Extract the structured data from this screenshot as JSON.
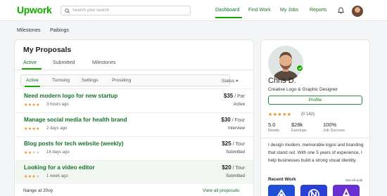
{
  "brand": {
    "logo": "Upwork",
    "accent": "#14a800",
    "link_green": "#16732c",
    "star_color": "#ef8b1a"
  },
  "header": {
    "search_placeholder": "Search your search",
    "nav": [
      "Dashboard",
      "Find Work",
      "My Jobs",
      "Reports"
    ],
    "active_nav": "Dashboard",
    "icons": [
      "search-icon",
      "bell-icon",
      "avatar"
    ]
  },
  "subnav": [
    "Milestones",
    "Paibings"
  ],
  "proposals": {
    "title": "My Proposals",
    "tabs": [
      "Active",
      "Submitted",
      "Milestones"
    ],
    "active_tab": "Active",
    "subtabs": [
      "Active",
      "Turnsing",
      "Settings",
      "Prosiding"
    ],
    "status_filter": "Status",
    "rows": [
      {
        "title": "Need modern logo for new startup",
        "rating": 4,
        "ago": "3 hours ago",
        "price": "$35",
        "unit": " / Par",
        "status": "Active",
        "highlight": false
      },
      {
        "title": "Manage social media for health brand",
        "rating": 4,
        "ago": "2 days ago",
        "price": "$30",
        "unit": " / Four",
        "status": "Interview",
        "highlight": false
      },
      {
        "title": "Blog posts for tech website (weekly)",
        "rating": 2,
        "ago": "16 days ago",
        "price": "$25",
        "unit": " / Tour",
        "status": "Submitted",
        "highlight": false
      },
      {
        "title": "Looking for a video editor",
        "rating": 3,
        "ago": "1 week ago",
        "price": "$20",
        "unit": " / Tour",
        "status": "Submitted",
        "highlight": true
      }
    ],
    "footer_range": "Nange at 20oy",
    "footer_link": "View all proposals"
  },
  "profile": {
    "name": "Chris D.",
    "role": "Creative Logo & Graphic Designer",
    "button": "Profile",
    "rating_stars": 5,
    "rating_text": "(0 142)",
    "stats": [
      {
        "value": "5.0",
        "label": "Reads"
      },
      {
        "value": "$28k",
        "label": "Earnings"
      },
      {
        "value": "100%",
        "label": "Job Success"
      }
    ],
    "bio": "I design modern, memorable logos and branding that stand out. With one 5 years of experience, I help businesses build a strong visual identity.",
    "recent_work_title": "Recent Work",
    "see_all": "See all work",
    "works": [
      {
        "icon": "be-logo-icon",
        "color": "#1e4fd6"
      },
      {
        "icon": "n-logo-icon",
        "color": "#2a3fd4"
      },
      {
        "icon": "a-logo-icon",
        "color": "#6a2fd2"
      }
    ]
  }
}
